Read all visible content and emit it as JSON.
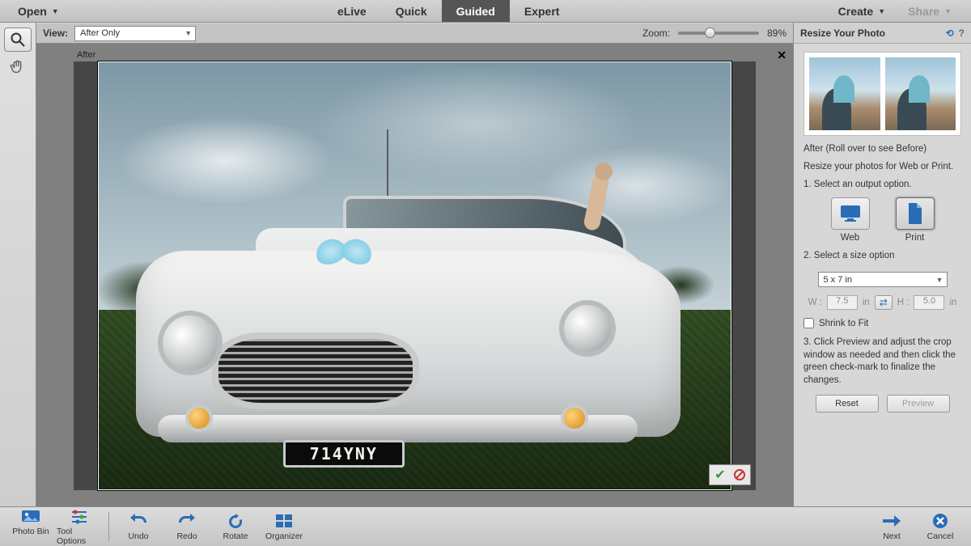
{
  "menubar": {
    "open": "Open",
    "tabs": {
      "elive": "eLive",
      "quick": "Quick",
      "guided": "Guided",
      "expert": "Expert"
    },
    "create": "Create",
    "share": "Share"
  },
  "optbar": {
    "view_label": "View:",
    "view_value": "After Only",
    "zoom_label": "Zoom:",
    "zoom_value": "89%"
  },
  "canvas": {
    "label": "After",
    "plate": "714YNY"
  },
  "panel": {
    "title": "Resize Your Photo",
    "rollover": "After (Roll over to see Before)",
    "intro": "Resize your photos for Web or Print.",
    "step1": "1. Select an output option.",
    "web": "Web",
    "print": "Print",
    "step2": "2. Select a size option",
    "size_value": "5 x 7 in",
    "w_label": "W :",
    "w_value": "7.5",
    "h_label": "H :",
    "h_value": "5.0",
    "unit": "in",
    "shrink": "Shrink to Fit",
    "step3": "3. Click Preview and adjust the crop window as needed and then click the green check-mark to finalize the changes.",
    "reset": "Reset",
    "preview": "Preview"
  },
  "bottom": {
    "photobin": "Photo Bin",
    "toolopt": "Tool Options",
    "undo": "Undo",
    "redo": "Redo",
    "rotate": "Rotate",
    "organizer": "Organizer",
    "next": "Next",
    "cancel": "Cancel"
  }
}
